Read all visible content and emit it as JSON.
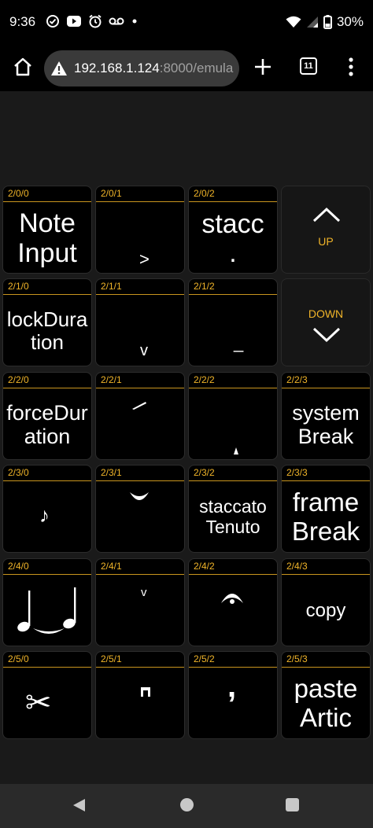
{
  "status_bar": {
    "time": "9:36",
    "battery": "30%",
    "icons": [
      "check-circle-icon",
      "youtube-icon",
      "alarm-icon",
      "voicemail-icon",
      "dot-icon",
      "wifi-icon",
      "signal-icon",
      "battery-icon"
    ]
  },
  "browser": {
    "url_host": "192.168.1.124",
    "url_rest": ":8000/emula",
    "tab_count": "11",
    "icons": [
      "home-icon",
      "warning-icon",
      "plus-icon",
      "tabs-icon",
      "menu-icon"
    ]
  },
  "grid": {
    "row0": {
      "c0": {
        "id": "2/0/0",
        "label": "Note Input"
      },
      "c1": {
        "id": "2/0/1",
        "glyph": ">"
      },
      "c2": {
        "id": "2/0/2",
        "label": "stacc",
        "glyph": "."
      },
      "up": {
        "label": "UP"
      }
    },
    "row1": {
      "c0": {
        "id": "2/1/0",
        "label": "lockDuration"
      },
      "c1": {
        "id": "2/1/1",
        "glyph": "v"
      },
      "c2": {
        "id": "2/1/2",
        "glyph": "_"
      },
      "down": {
        "label": "DOWN"
      }
    },
    "row2": {
      "c0": {
        "id": "2/2/0",
        "label": "forceDuration"
      },
      "c1": {
        "id": "2/2/1"
      },
      "c2": {
        "id": "2/2/2"
      },
      "c3": {
        "id": "2/2/3",
        "label": "system Break"
      }
    },
    "row3": {
      "c0": {
        "id": "2/3/0",
        "glyph": "♪"
      },
      "c1": {
        "id": "2/3/1"
      },
      "c2": {
        "id": "2/3/2",
        "label": "staccato Tenuto"
      },
      "c3": {
        "id": "2/3/3",
        "label": "frame Break"
      }
    },
    "row4": {
      "c0": {
        "id": "2/4/0"
      },
      "c1": {
        "id": "2/4/1",
        "glyph": "v"
      },
      "c2": {
        "id": "2/4/2"
      },
      "c3": {
        "id": "2/4/3",
        "label": "copy"
      }
    },
    "row5": {
      "c0": {
        "id": "2/5/0",
        "glyph": "✂"
      },
      "c1": {
        "id": "2/5/1"
      },
      "c2": {
        "id": "2/5/2",
        "glyph": ","
      },
      "c3": {
        "id": "2/5/3",
        "label": "paste Artic"
      }
    }
  },
  "colors": {
    "accent": "#f0b429",
    "cell_bg": "#000000",
    "page_bg": "#1a1a1a"
  }
}
